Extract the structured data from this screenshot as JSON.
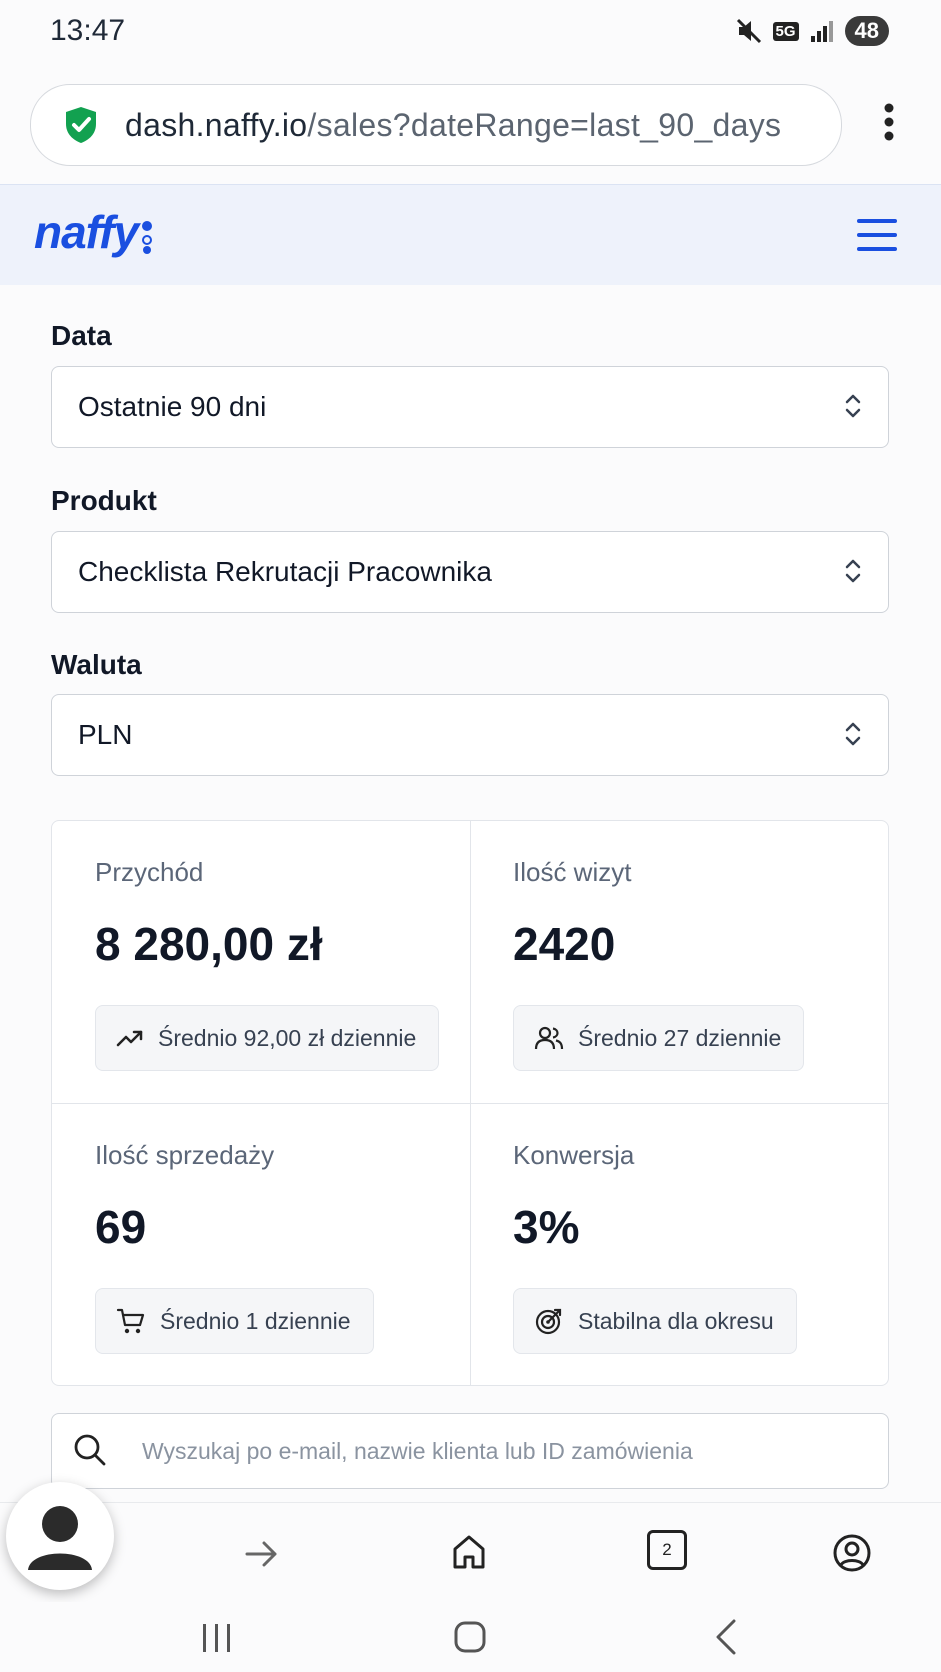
{
  "status_bar": {
    "time": "13:47",
    "network": "5G",
    "battery": "48"
  },
  "browser": {
    "url_domain": "dash.naffy.io",
    "url_path": "/sales?dateRange=last_90_days"
  },
  "header": {
    "logo": "naffy"
  },
  "filters": {
    "date": {
      "label": "Data",
      "value": "Ostatnie 90 dni"
    },
    "product": {
      "label": "Produkt",
      "value": "Checklista Rekrutacji Pracownika"
    },
    "currency": {
      "label": "Waluta",
      "value": "PLN"
    }
  },
  "stats": {
    "revenue": {
      "label": "Przychód",
      "value": "8 280,00 zł",
      "note": "Średnio 92,00 zł dziennie"
    },
    "visits": {
      "label": "Ilość wizyt",
      "value": "2420",
      "note": "Średnio 27 dziennie"
    },
    "sales": {
      "label": "Ilość sprzedaży",
      "value": "69",
      "note": "Średnio 1 dziennie"
    },
    "conversion": {
      "label": "Konwersja",
      "value": "3%",
      "note": "Stabilna dla okresu"
    }
  },
  "search": {
    "placeholder": "Wyszukaj po e-mail, nazwie klienta lub ID zamówienia"
  },
  "bottom_nav": {
    "tab_count": "2"
  },
  "colors": {
    "brand": "#1a4fe0",
    "header_bg": "#eef2fb",
    "shield": "#12a150"
  }
}
